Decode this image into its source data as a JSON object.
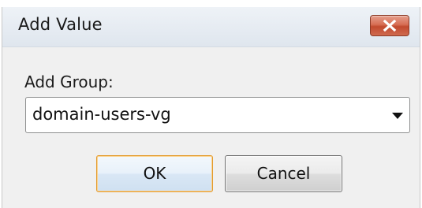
{
  "dialog": {
    "title": "Add Value",
    "close_icon": "close-x-icon"
  },
  "form": {
    "group_label": "Add Group:",
    "group_select": {
      "selected_value": "domain-users-vg",
      "arrow_icon": "dropdown-arrow-icon"
    }
  },
  "buttons": {
    "ok_label": "OK",
    "cancel_label": "Cancel"
  },
  "colors": {
    "close_button": "#c9553a",
    "default_button_border": "#e39a2c",
    "dialog_background": "#f0f0f0"
  }
}
